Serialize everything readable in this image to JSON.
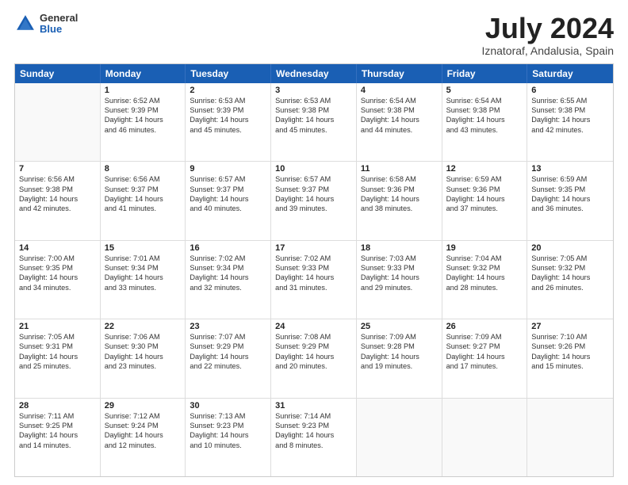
{
  "logo": {
    "general": "General",
    "blue": "Blue"
  },
  "title": "July 2024",
  "subtitle": "Iznatoraf, Andalusia, Spain",
  "header_days": [
    "Sunday",
    "Monday",
    "Tuesday",
    "Wednesday",
    "Thursday",
    "Friday",
    "Saturday"
  ],
  "weeks": [
    [
      {
        "day": "",
        "sunrise": "",
        "sunset": "",
        "daylight": "",
        "empty": true
      },
      {
        "day": "1",
        "sunrise": "Sunrise: 6:52 AM",
        "sunset": "Sunset: 9:39 PM",
        "daylight": "Daylight: 14 hours",
        "minutes": "and 46 minutes."
      },
      {
        "day": "2",
        "sunrise": "Sunrise: 6:53 AM",
        "sunset": "Sunset: 9:39 PM",
        "daylight": "Daylight: 14 hours",
        "minutes": "and 45 minutes."
      },
      {
        "day": "3",
        "sunrise": "Sunrise: 6:53 AM",
        "sunset": "Sunset: 9:38 PM",
        "daylight": "Daylight: 14 hours",
        "minutes": "and 45 minutes."
      },
      {
        "day": "4",
        "sunrise": "Sunrise: 6:54 AM",
        "sunset": "Sunset: 9:38 PM",
        "daylight": "Daylight: 14 hours",
        "minutes": "and 44 minutes."
      },
      {
        "day": "5",
        "sunrise": "Sunrise: 6:54 AM",
        "sunset": "Sunset: 9:38 PM",
        "daylight": "Daylight: 14 hours",
        "minutes": "and 43 minutes."
      },
      {
        "day": "6",
        "sunrise": "Sunrise: 6:55 AM",
        "sunset": "Sunset: 9:38 PM",
        "daylight": "Daylight: 14 hours",
        "minutes": "and 42 minutes."
      }
    ],
    [
      {
        "day": "7",
        "sunrise": "Sunrise: 6:56 AM",
        "sunset": "Sunset: 9:38 PM",
        "daylight": "Daylight: 14 hours",
        "minutes": "and 42 minutes."
      },
      {
        "day": "8",
        "sunrise": "Sunrise: 6:56 AM",
        "sunset": "Sunset: 9:37 PM",
        "daylight": "Daylight: 14 hours",
        "minutes": "and 41 minutes."
      },
      {
        "day": "9",
        "sunrise": "Sunrise: 6:57 AM",
        "sunset": "Sunset: 9:37 PM",
        "daylight": "Daylight: 14 hours",
        "minutes": "and 40 minutes."
      },
      {
        "day": "10",
        "sunrise": "Sunrise: 6:57 AM",
        "sunset": "Sunset: 9:37 PM",
        "daylight": "Daylight: 14 hours",
        "minutes": "and 39 minutes."
      },
      {
        "day": "11",
        "sunrise": "Sunrise: 6:58 AM",
        "sunset": "Sunset: 9:36 PM",
        "daylight": "Daylight: 14 hours",
        "minutes": "and 38 minutes."
      },
      {
        "day": "12",
        "sunrise": "Sunrise: 6:59 AM",
        "sunset": "Sunset: 9:36 PM",
        "daylight": "Daylight: 14 hours",
        "minutes": "and 37 minutes."
      },
      {
        "day": "13",
        "sunrise": "Sunrise: 6:59 AM",
        "sunset": "Sunset: 9:35 PM",
        "daylight": "Daylight: 14 hours",
        "minutes": "and 36 minutes."
      }
    ],
    [
      {
        "day": "14",
        "sunrise": "Sunrise: 7:00 AM",
        "sunset": "Sunset: 9:35 PM",
        "daylight": "Daylight: 14 hours",
        "minutes": "and 34 minutes."
      },
      {
        "day": "15",
        "sunrise": "Sunrise: 7:01 AM",
        "sunset": "Sunset: 9:34 PM",
        "daylight": "Daylight: 14 hours",
        "minutes": "and 33 minutes."
      },
      {
        "day": "16",
        "sunrise": "Sunrise: 7:02 AM",
        "sunset": "Sunset: 9:34 PM",
        "daylight": "Daylight: 14 hours",
        "minutes": "and 32 minutes."
      },
      {
        "day": "17",
        "sunrise": "Sunrise: 7:02 AM",
        "sunset": "Sunset: 9:33 PM",
        "daylight": "Daylight: 14 hours",
        "minutes": "and 31 minutes."
      },
      {
        "day": "18",
        "sunrise": "Sunrise: 7:03 AM",
        "sunset": "Sunset: 9:33 PM",
        "daylight": "Daylight: 14 hours",
        "minutes": "and 29 minutes."
      },
      {
        "day": "19",
        "sunrise": "Sunrise: 7:04 AM",
        "sunset": "Sunset: 9:32 PM",
        "daylight": "Daylight: 14 hours",
        "minutes": "and 28 minutes."
      },
      {
        "day": "20",
        "sunrise": "Sunrise: 7:05 AM",
        "sunset": "Sunset: 9:32 PM",
        "daylight": "Daylight: 14 hours",
        "minutes": "and 26 minutes."
      }
    ],
    [
      {
        "day": "21",
        "sunrise": "Sunrise: 7:05 AM",
        "sunset": "Sunset: 9:31 PM",
        "daylight": "Daylight: 14 hours",
        "minutes": "and 25 minutes."
      },
      {
        "day": "22",
        "sunrise": "Sunrise: 7:06 AM",
        "sunset": "Sunset: 9:30 PM",
        "daylight": "Daylight: 14 hours",
        "minutes": "and 23 minutes."
      },
      {
        "day": "23",
        "sunrise": "Sunrise: 7:07 AM",
        "sunset": "Sunset: 9:29 PM",
        "daylight": "Daylight: 14 hours",
        "minutes": "and 22 minutes."
      },
      {
        "day": "24",
        "sunrise": "Sunrise: 7:08 AM",
        "sunset": "Sunset: 9:29 PM",
        "daylight": "Daylight: 14 hours",
        "minutes": "and 20 minutes."
      },
      {
        "day": "25",
        "sunrise": "Sunrise: 7:09 AM",
        "sunset": "Sunset: 9:28 PM",
        "daylight": "Daylight: 14 hours",
        "minutes": "and 19 minutes."
      },
      {
        "day": "26",
        "sunrise": "Sunrise: 7:09 AM",
        "sunset": "Sunset: 9:27 PM",
        "daylight": "Daylight: 14 hours",
        "minutes": "and 17 minutes."
      },
      {
        "day": "27",
        "sunrise": "Sunrise: 7:10 AM",
        "sunset": "Sunset: 9:26 PM",
        "daylight": "Daylight: 14 hours",
        "minutes": "and 15 minutes."
      }
    ],
    [
      {
        "day": "28",
        "sunrise": "Sunrise: 7:11 AM",
        "sunset": "Sunset: 9:25 PM",
        "daylight": "Daylight: 14 hours",
        "minutes": "and 14 minutes."
      },
      {
        "day": "29",
        "sunrise": "Sunrise: 7:12 AM",
        "sunset": "Sunset: 9:24 PM",
        "daylight": "Daylight: 14 hours",
        "minutes": "and 12 minutes."
      },
      {
        "day": "30",
        "sunrise": "Sunrise: 7:13 AM",
        "sunset": "Sunset: 9:23 PM",
        "daylight": "Daylight: 14 hours",
        "minutes": "and 10 minutes."
      },
      {
        "day": "31",
        "sunrise": "Sunrise: 7:14 AM",
        "sunset": "Sunset: 9:23 PM",
        "daylight": "Daylight: 14 hours",
        "minutes": "and 8 minutes."
      },
      {
        "day": "",
        "sunrise": "",
        "sunset": "",
        "daylight": "",
        "minutes": "",
        "empty": true
      },
      {
        "day": "",
        "sunrise": "",
        "sunset": "",
        "daylight": "",
        "minutes": "",
        "empty": true
      },
      {
        "day": "",
        "sunrise": "",
        "sunset": "",
        "daylight": "",
        "minutes": "",
        "empty": true
      }
    ]
  ]
}
